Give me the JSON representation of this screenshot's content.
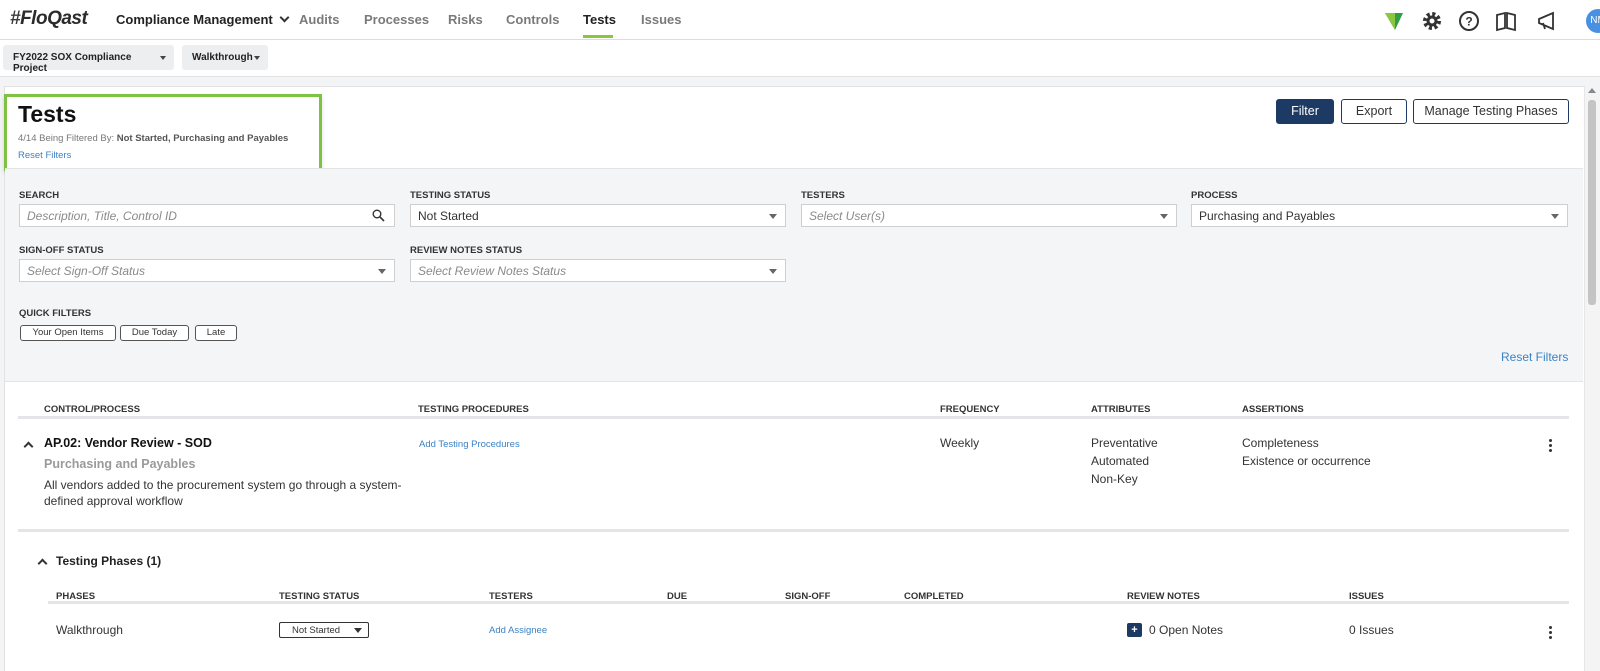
{
  "app": {
    "logo": "FloQast",
    "module": "Compliance Management",
    "nav": [
      "Audits",
      "Processes",
      "Risks",
      "Controls",
      "Tests",
      "Issues"
    ],
    "active_nav": "Tests",
    "user_initials": "NM"
  },
  "subbar": {
    "project": "FY2022 SOX Compliance Project",
    "phase": "Walkthrough"
  },
  "header": {
    "title": "Tests",
    "filter_count": "4/14 Being Filtered By:",
    "filter_values": "Not Started, Purchasing and Payables",
    "reset_filters": "Reset Filters",
    "buttons": {
      "filter": "Filter",
      "export": "Export",
      "manage": "Manage Testing Phases"
    }
  },
  "filters": {
    "search": {
      "label": "SEARCH",
      "placeholder": "Description, Title, Control ID"
    },
    "testing_status": {
      "label": "TESTING STATUS",
      "value": "Not Started"
    },
    "testers": {
      "label": "TESTERS",
      "placeholder": "Select User(s)"
    },
    "process": {
      "label": "PROCESS",
      "value": "Purchasing and Payables"
    },
    "signoff": {
      "label": "SIGN-OFF STATUS",
      "placeholder": "Select Sign-Off Status"
    },
    "review_notes": {
      "label": "REVIEW NOTES STATUS",
      "placeholder": "Select Review Notes Status"
    },
    "quick": {
      "label": "QUICK FILTERS",
      "items": [
        "Your Open Items",
        "Due Today",
        "Late"
      ]
    },
    "reset": "Reset Filters"
  },
  "table": {
    "columns": [
      "CONTROL/PROCESS",
      "TESTING PROCEDURES",
      "FREQUENCY",
      "ATTRIBUTES",
      "ASSERTIONS"
    ],
    "row": {
      "title": "AP.02: Vendor Review - SOD",
      "process": "Purchasing and Payables",
      "description": "All vendors added to the procurement system go through a system-defined approval workflow",
      "procedures_link": "Add Testing Procedures",
      "frequency": "Weekly",
      "attributes": [
        "Preventative",
        "Automated",
        "Non-Key"
      ],
      "assertions": [
        "Completeness",
        "Existence or occurrence"
      ]
    }
  },
  "phases": {
    "title": "Testing Phases (1)",
    "columns": [
      "PHASES",
      "TESTING STATUS",
      "TESTERS",
      "DUE",
      "SIGN-OFF",
      "COMPLETED",
      "REVIEW NOTES",
      "ISSUES"
    ],
    "row": {
      "phase": "Walkthrough",
      "status": "Not Started",
      "testers_link": "Add Assignee",
      "notes": "0 Open Notes",
      "issues": "0 Issues"
    }
  },
  "colors": {
    "accent_green": "#8cc63f",
    "navy": "#1c3a64",
    "link": "#3b82c4"
  }
}
